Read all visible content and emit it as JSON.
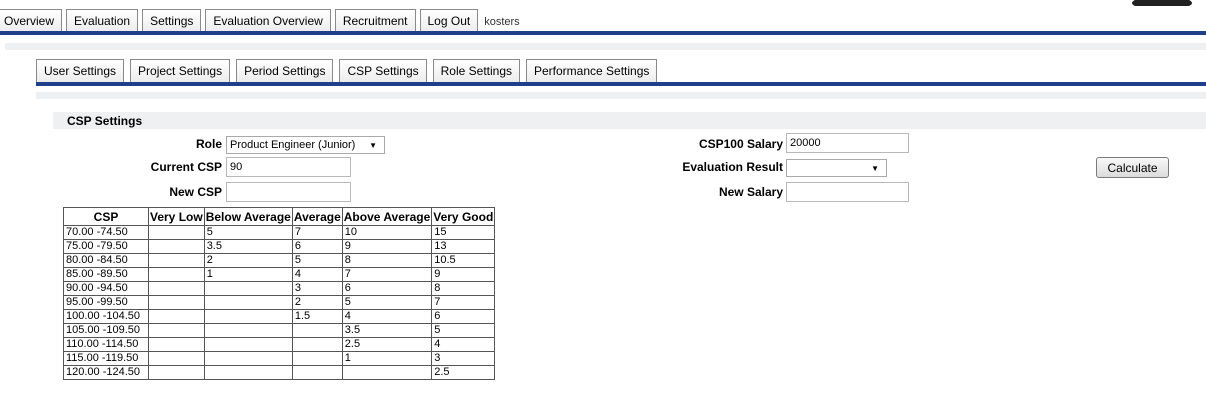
{
  "main_nav": {
    "items": [
      "Overview",
      "Evaluation",
      "Settings",
      "Evaluation Overview",
      "Recruitment",
      "Log Out"
    ],
    "username": "kosters"
  },
  "sub_nav": {
    "items": [
      "User Settings",
      "Project Settings",
      "Period Settings",
      "CSP Settings",
      "Role Settings",
      "Performance Settings"
    ]
  },
  "section": {
    "title": "CSP Settings"
  },
  "form": {
    "role_label": "Role",
    "role_value": "Product Engineer (Junior)",
    "current_csp_label": "Current CSP",
    "current_csp_value": "90",
    "new_csp_label": "New CSP",
    "new_csp_value": "",
    "csp100_salary_label": "CSP100 Salary",
    "csp100_salary_value": "20000",
    "evaluation_result_label": "Evaluation Result",
    "evaluation_result_value": "",
    "new_salary_label": "New Salary",
    "new_salary_value": "",
    "calculate_label": "Calculate"
  },
  "table": {
    "headers": [
      "CSP",
      "Very Low",
      "Below Average",
      "Average",
      "Above Average",
      "Very Good"
    ],
    "rows": [
      [
        "70.00 -74.50",
        "",
        "5",
        "7",
        "10",
        "15"
      ],
      [
        "75.00 -79.50",
        "",
        "3.5",
        "6",
        "9",
        "13"
      ],
      [
        "80.00 -84.50",
        "",
        "2",
        "5",
        "8",
        "10.5"
      ],
      [
        "85.00 -89.50",
        "",
        "1",
        "4",
        "7",
        "9"
      ],
      [
        "90.00 -94.50",
        "",
        "",
        "3",
        "6",
        "8"
      ],
      [
        "95.00 -99.50",
        "",
        "",
        "2",
        "5",
        "7"
      ],
      [
        "100.00 -104.50",
        "",
        "",
        "1.5",
        "4",
        "6"
      ],
      [
        "105.00 -109.50",
        "",
        "",
        "",
        "3.5",
        "5"
      ],
      [
        "110.00 -114.50",
        "",
        "",
        "",
        "2.5",
        "4"
      ],
      [
        "115.00 -119.50",
        "",
        "",
        "",
        "1",
        "3"
      ],
      [
        "120.00 -124.50",
        "",
        "",
        "",
        "",
        "2.5"
      ]
    ]
  },
  "colors": {
    "nav_line": "#1f3f8c",
    "section_bg": "#eef0f2"
  }
}
